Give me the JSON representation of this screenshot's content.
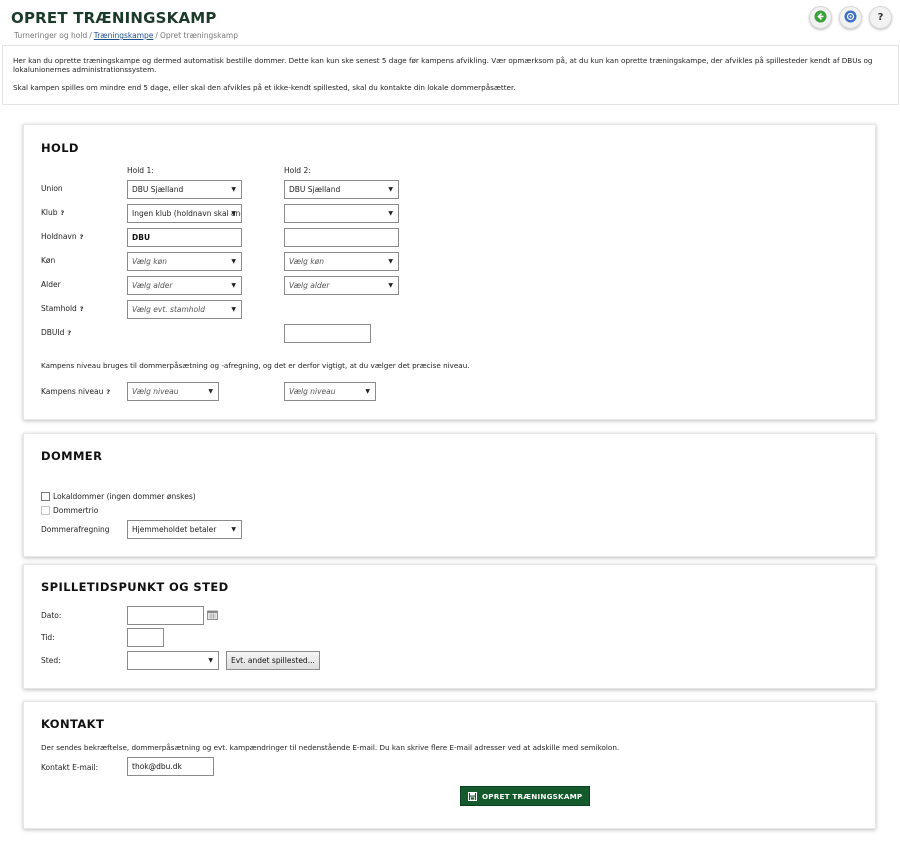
{
  "header": {
    "title": "OPRET TRÆNINGSKAMP",
    "breadcrumb": [
      "Turneringer og hold",
      "Træningskampe",
      "Opret træningskamp"
    ],
    "separator": "/",
    "help_label": "?"
  },
  "info": {
    "paragraph1": "Her kan du oprette træningskampe og dermed automatisk bestille dommer. Dette kan kun ske senest 5 dage før kampens afvikling. Vær opmærksom på, at du kun kan oprette træningskampe, der afvikles på spillesteder kendt af DBUs og lokalunionernes administrationssystem.",
    "paragraph2": "Skal kampen spilles om mindre end 5 dage, eller skal den afvikles på et ikke-kendt spillested, skal du kontakte din lokale dommerpåsætter."
  },
  "hold": {
    "title": "HOLD",
    "hold1_header": "Hold 1:",
    "hold2_header": "Hold 2:",
    "help_mark": "?",
    "labels": {
      "union": "Union",
      "klub": "Klub",
      "holdnavn": "Holdnavn",
      "kon": "Køn",
      "alder": "Alder",
      "stamhold": "Stamhold",
      "dbuid": "DBUId"
    },
    "hold1": {
      "union": "DBU Sjælland",
      "klub": "Ingen klub (holdnavn skal angives)",
      "holdnavn": "DBU",
      "kon": "Vælg køn",
      "alder": "Vælg alder",
      "stamhold": "Vælg evt. stamhold"
    },
    "hold2": {
      "union": "DBU Sjælland",
      "klub": "",
      "holdnavn": "",
      "kon": "Vælg køn",
      "alder": "Vælg alder",
      "dbuid": ""
    },
    "niveau_note": "Kampens niveau bruges til dommerpåsætning og -afregning, og det er derfor vigtigt, at du vælger det præcise niveau.",
    "niveau_label": "Kampens niveau",
    "niveau1": "Vælg niveau",
    "niveau2": "Vælg niveau"
  },
  "dommer": {
    "title": "DOMMER",
    "lokaldommer": "Lokaldommer (ingen dommer ønskes)",
    "dommertrio": "Dommertrio",
    "afregning_label": "Dommerafregning",
    "afregning_value": "Hjemmeholdet betaler"
  },
  "spilletid": {
    "title": "SPILLETIDSPUNKT OG STED",
    "dato_label": "Dato:",
    "tid_label": "Tid:",
    "sted_label": "Sted:",
    "dato_value": "",
    "tid_value": "",
    "sted_value": "",
    "other_venue_button": "Evt. andet spillested..."
  },
  "kontakt": {
    "title": "KONTAKT",
    "note": "Der sendes bekræftelse, dommerpåsætning og evt. kampændringer til nedenstående E-mail. Du kan skrive flere E-mail adresser ved at adskille med semikolon.",
    "email_label": "Kontakt E-mail:",
    "email_value": "thok@dbu.dk",
    "submit_label": "OPRET TRÆNINGSKAMP"
  },
  "colors": {
    "accent_green": "#145a2c",
    "title_green": "#1c3a2a",
    "link_blue": "#1f4e8a",
    "back_icon_green": "#3aa03a",
    "info_icon_blue": "#3a6fc4"
  },
  "icons": [
    "back-arrow-icon",
    "info-icon",
    "help-icon",
    "help-question-icon",
    "caret-down-icon",
    "calendar-icon",
    "save-disk-icon"
  ]
}
